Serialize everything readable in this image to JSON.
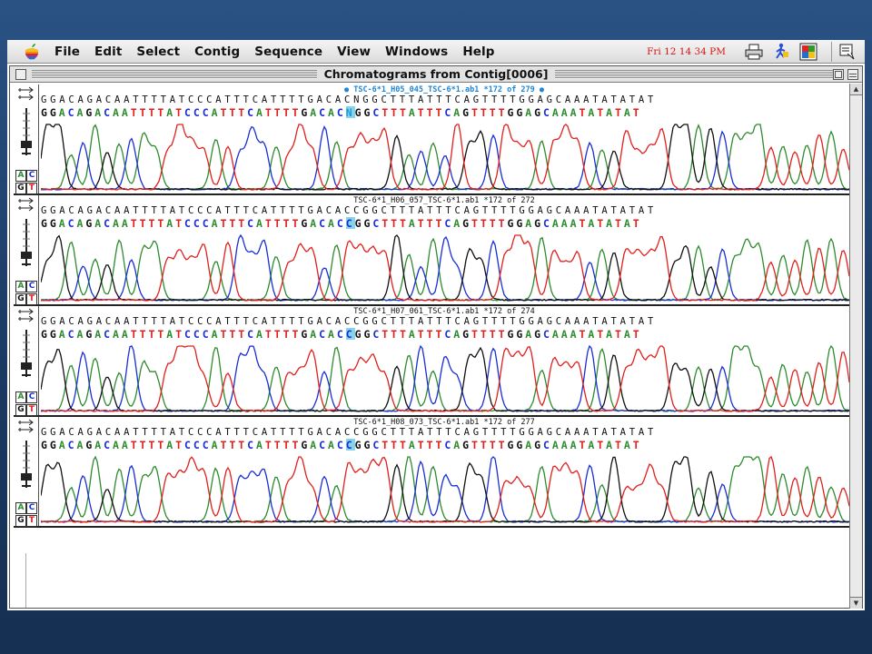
{
  "menubar": {
    "items": [
      "File",
      "Edit",
      "Select",
      "Contig",
      "Sequence",
      "View",
      "Windows",
      "Help"
    ],
    "clock": "Fri 12 14 34 PM",
    "icons": [
      "apple-logo",
      "printer-icon",
      "walker-icon",
      "app-switcher-icon",
      "help-balloon-icon"
    ]
  },
  "window": {
    "title": "Chromatograms from Contig[0006]"
  },
  "base_labels": {
    "a": "A",
    "c": "C",
    "g": "G",
    "t": "T"
  },
  "colors": {
    "A": "#2e8b2e",
    "C": "#1a2ed6",
    "G": "#111111",
    "T": "#e0201c",
    "N": "#1a9ee0",
    "highlight": "#86d3ec"
  },
  "consensus": "GGACAGACAATTTTATCCCATTTCATTTTGACACNGGCTTTATTTCAGTTTTGGAGCAAATATATAT",
  "highlight_index": 34,
  "panels": [
    {
      "header": "● TSC-6*1_H05_045_TSC-6*1.ab1 *172 of 279 ●",
      "active": true,
      "consensus": "GGACAGACAATTTTATCCCATTTCATTTTGACACNGGCTTTATTTCAGTTTTGGAGCAAATATATAT",
      "read": "GGACAGACAATTTTATCCCATTTCATTTTGACACNGGCTTTATTTCAGTTTTGGAGCAAATATATAT"
    },
    {
      "header": "TSC-6*1_H06_057_TSC-6*1.ab1 *172 of 272",
      "active": false,
      "consensus": "GGACAGACAATTTTATCCCATTTCATTTTGACACCGGCTTTATTTCAGTTTTGGAGCAAATATATAT",
      "read": "GGACAGACAATTTTATCCCATTTCATTTTGACACCGGCTTTATTTCAGTTTTGGAGCAAATATATAT"
    },
    {
      "header": "TSC-6*1_H07_061_TSC-6*1.ab1 *172 of 274",
      "active": false,
      "consensus": "GGACAGACAATTTTATCCCATTTCATTTTGACACCGGCTTTATTTCAGTTTTGGAGCAAATATATAT",
      "read": "GGACAGACAATTTTATCCCATTTCATTTTGACACCGGCTTTATTTCAGTTTTGGAGCAAATATATAT"
    },
    {
      "header": "TSC-6*1_H08_073_TSC-6*1.ab1 *172 of 277",
      "active": false,
      "consensus": "GGACAGACAATTTTATCCCATTTCATTTTGACACCGGCTTTATTTCAGTTTTGGAGCAAATATATAT",
      "read": "GGACAGACAATTTTATCCCATTTCATTTTGACACCGGCTTTATTTCAGTTTTGGAGCAAATATATAT"
    }
  ]
}
